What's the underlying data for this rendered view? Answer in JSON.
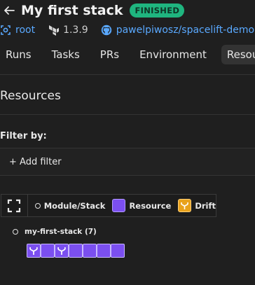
{
  "header": {
    "title": "My first stack",
    "status": "FINISHED"
  },
  "meta": {
    "space": "root",
    "version": "1.3.9",
    "repository": "pawelpiwosz/spacelift-demo"
  },
  "tabs": [
    {
      "label": "Runs",
      "active": false
    },
    {
      "label": "Tasks",
      "active": false
    },
    {
      "label": "PRs",
      "active": false
    },
    {
      "label": "Environment",
      "active": false
    },
    {
      "label": "Resources",
      "active": true
    }
  ],
  "section": {
    "title": "Resources"
  },
  "filter": {
    "label": "Filter by:",
    "add_label": "+ Add filter"
  },
  "legend": {
    "module_stack": "Module/Stack",
    "resource": "Resource",
    "drift": "Drift"
  },
  "tree": {
    "stack_label": "my-first-stack (7)",
    "resources": [
      {
        "type": "resource",
        "icon": "provider-icon"
      },
      {
        "type": "resource",
        "icon": "none"
      },
      {
        "type": "resource",
        "icon": "provider-icon"
      },
      {
        "type": "resource",
        "icon": "none"
      },
      {
        "type": "resource",
        "icon": "none"
      },
      {
        "type": "resource",
        "icon": "none"
      },
      {
        "type": "resource",
        "icon": "none"
      }
    ]
  },
  "colors": {
    "status_badge": "#1fb57f",
    "link": "#5aa9ff",
    "resource": "#7b4ff0",
    "drift": "#e9a21c"
  }
}
